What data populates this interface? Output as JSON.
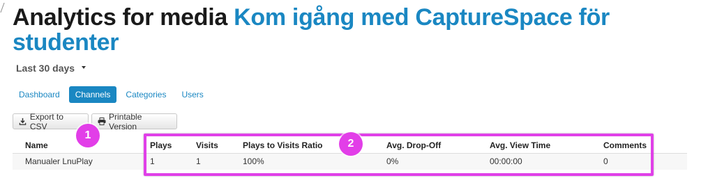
{
  "header": {
    "title_prefix": "Analytics for media",
    "media_name": "Kom igång med CaptureSpace för studenter"
  },
  "date_range": {
    "selected": "Last 30 days"
  },
  "tabs": [
    {
      "label": "Dashboard",
      "active": false
    },
    {
      "label": "Channels",
      "active": true
    },
    {
      "label": "Categories",
      "active": false
    },
    {
      "label": "Users",
      "active": false
    }
  ],
  "actions": {
    "export_label": "Export to CSV",
    "export_icon": "download-icon",
    "print_label": "Printable Version",
    "print_icon": "print-icon"
  },
  "table": {
    "columns": [
      "Name",
      "Plays",
      "Visits",
      "Plays to Visits Ratio",
      "Avg. Drop-Off",
      "Avg. View Time",
      "Comments"
    ],
    "rows": [
      [
        "Manualer LnuPlay",
        "1",
        "1",
        "100%",
        "0%",
        "00:00:00",
        "0"
      ]
    ]
  },
  "annotations": {
    "callout_1": "1",
    "callout_2": "2",
    "color": "#e040e8"
  },
  "colors": {
    "accent": "#1a87c2",
    "title": "#1a1a1a"
  }
}
